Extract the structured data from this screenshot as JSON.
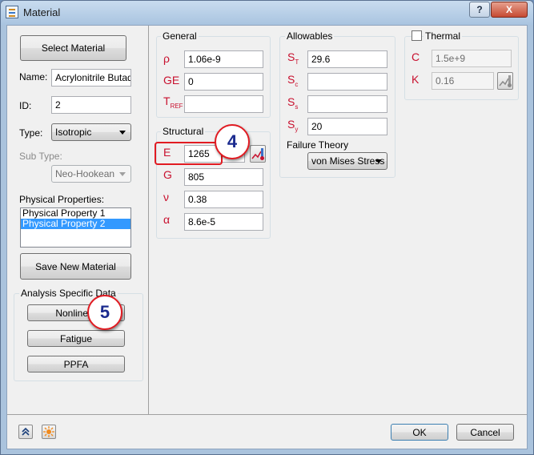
{
  "window": {
    "title": "Material",
    "help_label": "?",
    "close_label": "X"
  },
  "left": {
    "select_material_label": "Select Material",
    "name_label": "Name:",
    "name_value": "Acrylonitrile Butadie",
    "id_label": "ID:",
    "id_value": "2",
    "type_label": "Type:",
    "type_value": "Isotropic",
    "subtype_label": "Sub Type:",
    "subtype_value": "Neo-Hookean",
    "physical_label": "Physical Properties:",
    "physical_items": [
      "Physical Property 1",
      "Physical Property 2"
    ],
    "save_label": "Save New Material",
    "analysis_title": "Analysis Specific Data",
    "nonlinear_label": "Nonlinear",
    "fatigue_label": "Fatigue",
    "ppfa_label": "PPFA"
  },
  "general": {
    "title": "General",
    "rho_symbol": "ρ",
    "rho_value": "1.06e-9",
    "ge_symbol": "GE",
    "ge_value": "0",
    "tref_symbol": "T",
    "tref_sub": "REF",
    "tref_value": ""
  },
  "structural": {
    "title": "Structural",
    "e_symbol": "E",
    "e_value": "1265",
    "g_symbol": "G",
    "g_value": "805",
    "nu_symbol": "ν",
    "nu_value": "0.38",
    "alpha_symbol": "α",
    "alpha_value": "8.6e-5"
  },
  "allowables": {
    "title": "Allowables",
    "st_symbol": "S",
    "st_sub": "T",
    "st_value": "29.6",
    "sc_symbol": "S",
    "sc_sub": "c",
    "sc_value": "",
    "ss_symbol": "S",
    "ss_sub": "s",
    "ss_value": "",
    "sy_symbol": "S",
    "sy_sub": "y",
    "sy_value": "20",
    "failure_label": "Failure Theory",
    "failure_value": "von Mises Stress"
  },
  "thermal": {
    "title": "Thermal",
    "checked": false,
    "c_symbol": "C",
    "c_value": "1.5e+9",
    "k_symbol": "K",
    "k_value": "0.16"
  },
  "callouts": {
    "c4": "4",
    "c5": "5"
  },
  "footer": {
    "ok_label": "OK",
    "cancel_label": "Cancel"
  },
  "colors": {
    "symbol": "#c8102e",
    "callout_border": "#e11b22",
    "callout_text": "#1b2b8f",
    "list_selection": "#3399ff"
  },
  "icons": [
    "material-app-icon",
    "temperature-graph-icon",
    "collapse-up-icon",
    "explode-icon"
  ]
}
